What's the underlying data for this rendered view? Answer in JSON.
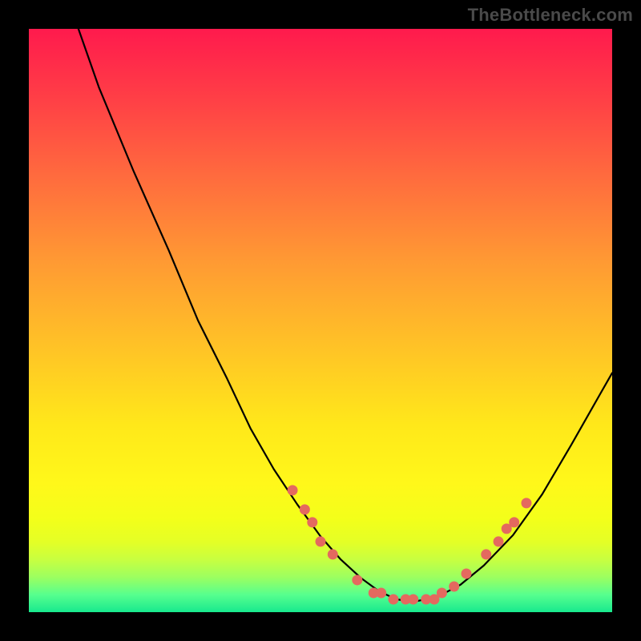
{
  "watermark": "TheBottleneck.com",
  "colors": {
    "dot": "#e4695f",
    "curve": "#000000"
  },
  "chart_data": {
    "type": "line",
    "title": "",
    "xlabel": "",
    "ylabel": "",
    "xlim": [
      0,
      100
    ],
    "ylim": [
      0,
      100
    ],
    "grid": false,
    "legend": false,
    "note": "Axes have no visible tick labels; values are fractional percentages of the plot area estimated from pixel positions (0 = left/bottom, 100 = right/top).",
    "series": [
      {
        "name": "bottleneck-curve",
        "x": [
          8.5,
          12,
          18,
          24,
          29,
          34,
          38,
          42,
          46,
          50,
          53.5,
          57,
          60,
          63,
          66,
          70,
          74,
          78,
          83,
          88,
          93,
          98,
          100
        ],
        "y": [
          100,
          90,
          75.5,
          62,
          50,
          40,
          31.5,
          24.5,
          18.5,
          13,
          9,
          5.8,
          3.6,
          2.2,
          1.8,
          2.6,
          4.7,
          8,
          13.2,
          20.2,
          28.7,
          37.5,
          41
        ]
      }
    ],
    "highlight_points": {
      "name": "red-dots",
      "comment": "Points emphasized near the curve minimum, estimated from pixels.",
      "points": [
        {
          "x": 45.2,
          "y": 20.9
        },
        {
          "x": 47.3,
          "y": 17.6
        },
        {
          "x": 48.6,
          "y": 15.4
        },
        {
          "x": 50.0,
          "y": 12.1
        },
        {
          "x": 52.1,
          "y": 9.9
        },
        {
          "x": 56.3,
          "y": 5.5
        },
        {
          "x": 59.1,
          "y": 3.3
        },
        {
          "x": 60.4,
          "y": 3.3
        },
        {
          "x": 62.5,
          "y": 2.2
        },
        {
          "x": 64.6,
          "y": 2.2
        },
        {
          "x": 65.9,
          "y": 2.2
        },
        {
          "x": 68.1,
          "y": 2.2
        },
        {
          "x": 69.5,
          "y": 2.2
        },
        {
          "x": 70.8,
          "y": 3.3
        },
        {
          "x": 72.9,
          "y": 4.4
        },
        {
          "x": 75.0,
          "y": 6.6
        },
        {
          "x": 78.4,
          "y": 9.9
        },
        {
          "x": 80.5,
          "y": 12.1
        },
        {
          "x": 81.9,
          "y": 14.3
        },
        {
          "x": 83.2,
          "y": 15.4
        },
        {
          "x": 85.3,
          "y": 18.7
        }
      ]
    }
  }
}
